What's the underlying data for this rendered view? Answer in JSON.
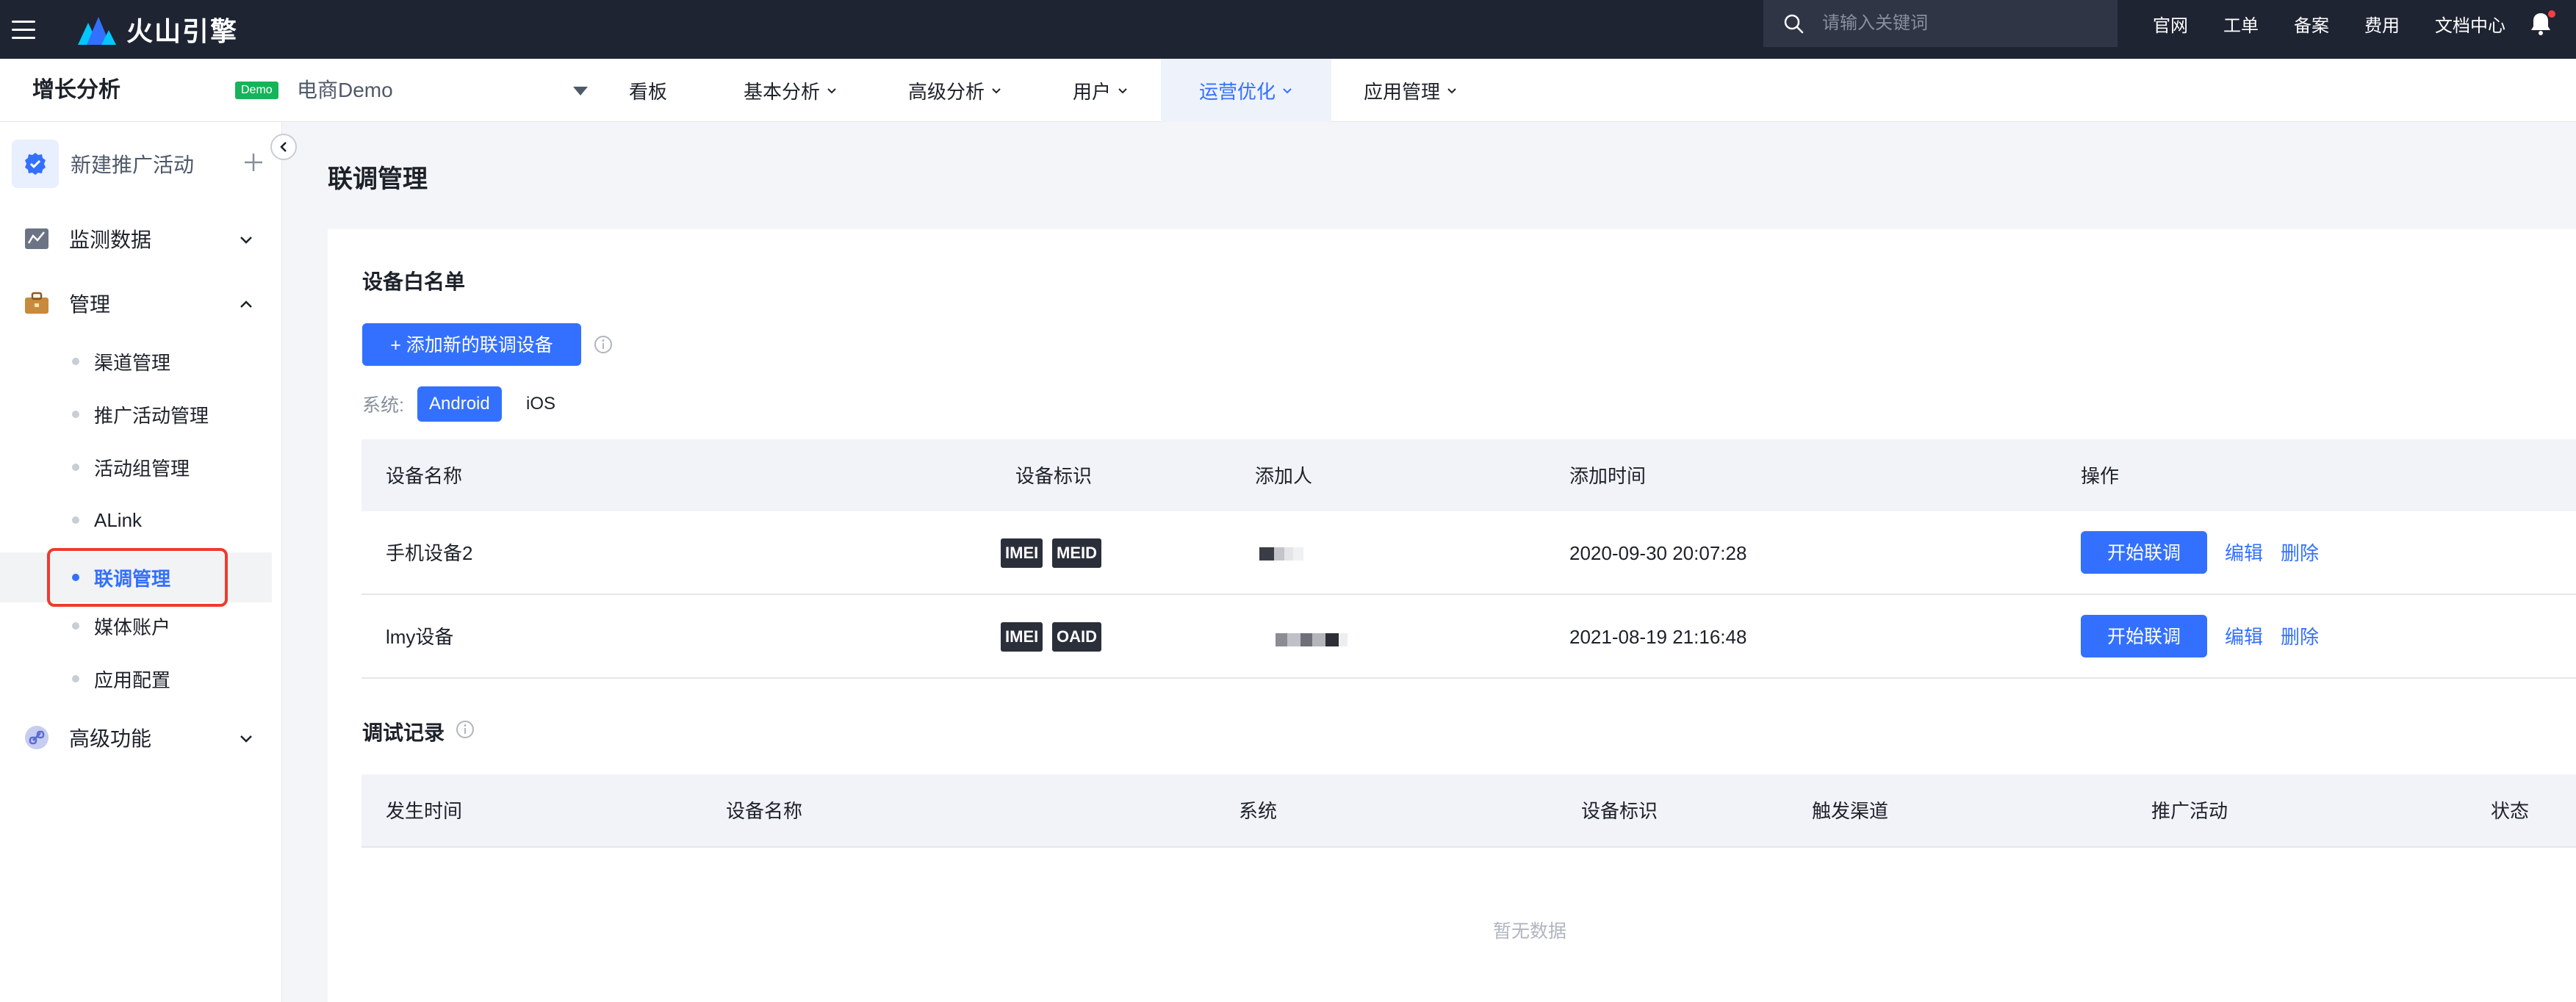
{
  "topbar": {
    "brand": "火山引擎",
    "search_placeholder": "请输入关键词",
    "links": [
      "官网",
      "工单",
      "备案",
      "费用",
      "文档中心"
    ]
  },
  "subnav": {
    "product": "增长分析",
    "demo_badge": "Demo",
    "app_name": "电商Demo",
    "items": [
      "看板",
      "基本分析",
      "高级分析",
      "用户",
      "运营优化",
      "应用管理"
    ],
    "active_item": "运营优化"
  },
  "sidebar": {
    "new_campaign": "新建推广活动",
    "sections": {
      "monitor": "监测数据",
      "manage": "管理",
      "advanced": "高级功能"
    },
    "items": [
      "渠道管理",
      "推广活动管理",
      "活动组管理",
      "ALink",
      "联调管理",
      "媒体账户",
      "应用配置"
    ],
    "active_item": "联调管理"
  },
  "main": {
    "page_title": "联调管理",
    "whitelist": {
      "title": "设备白名单",
      "add_button": "+ 添加新的联调设备",
      "os_label": "系统:",
      "os_options": [
        "Android",
        "iOS"
      ],
      "os_selected": "Android",
      "columns": [
        "设备名称",
        "设备标识",
        "添加人",
        "添加时间",
        "操作"
      ],
      "rows": [
        {
          "name": "手机设备2",
          "tags": [
            "IMEI",
            "MEID"
          ],
          "added_at": "2020-09-30 20:07:28",
          "start": "开始联调",
          "edit": "编辑",
          "delete": "删除"
        },
        {
          "name": "lmy设备",
          "tags": [
            "IMEI",
            "OAID"
          ],
          "added_at": "2021-08-19 21:16:48",
          "start": "开始联调",
          "edit": "编辑",
          "delete": "删除"
        }
      ]
    },
    "debug_log": {
      "title": "调试记录",
      "columns": [
        "发生时间",
        "设备名称",
        "系统",
        "设备标识",
        "触发渠道",
        "推广活动",
        "状态"
      ],
      "empty_text": "暂无数据"
    }
  },
  "colors": {
    "accent": "#3370ff",
    "topbar_bg": "#1f2433",
    "highlight": "#f03a2e",
    "demo_badge": "#16b45a"
  }
}
